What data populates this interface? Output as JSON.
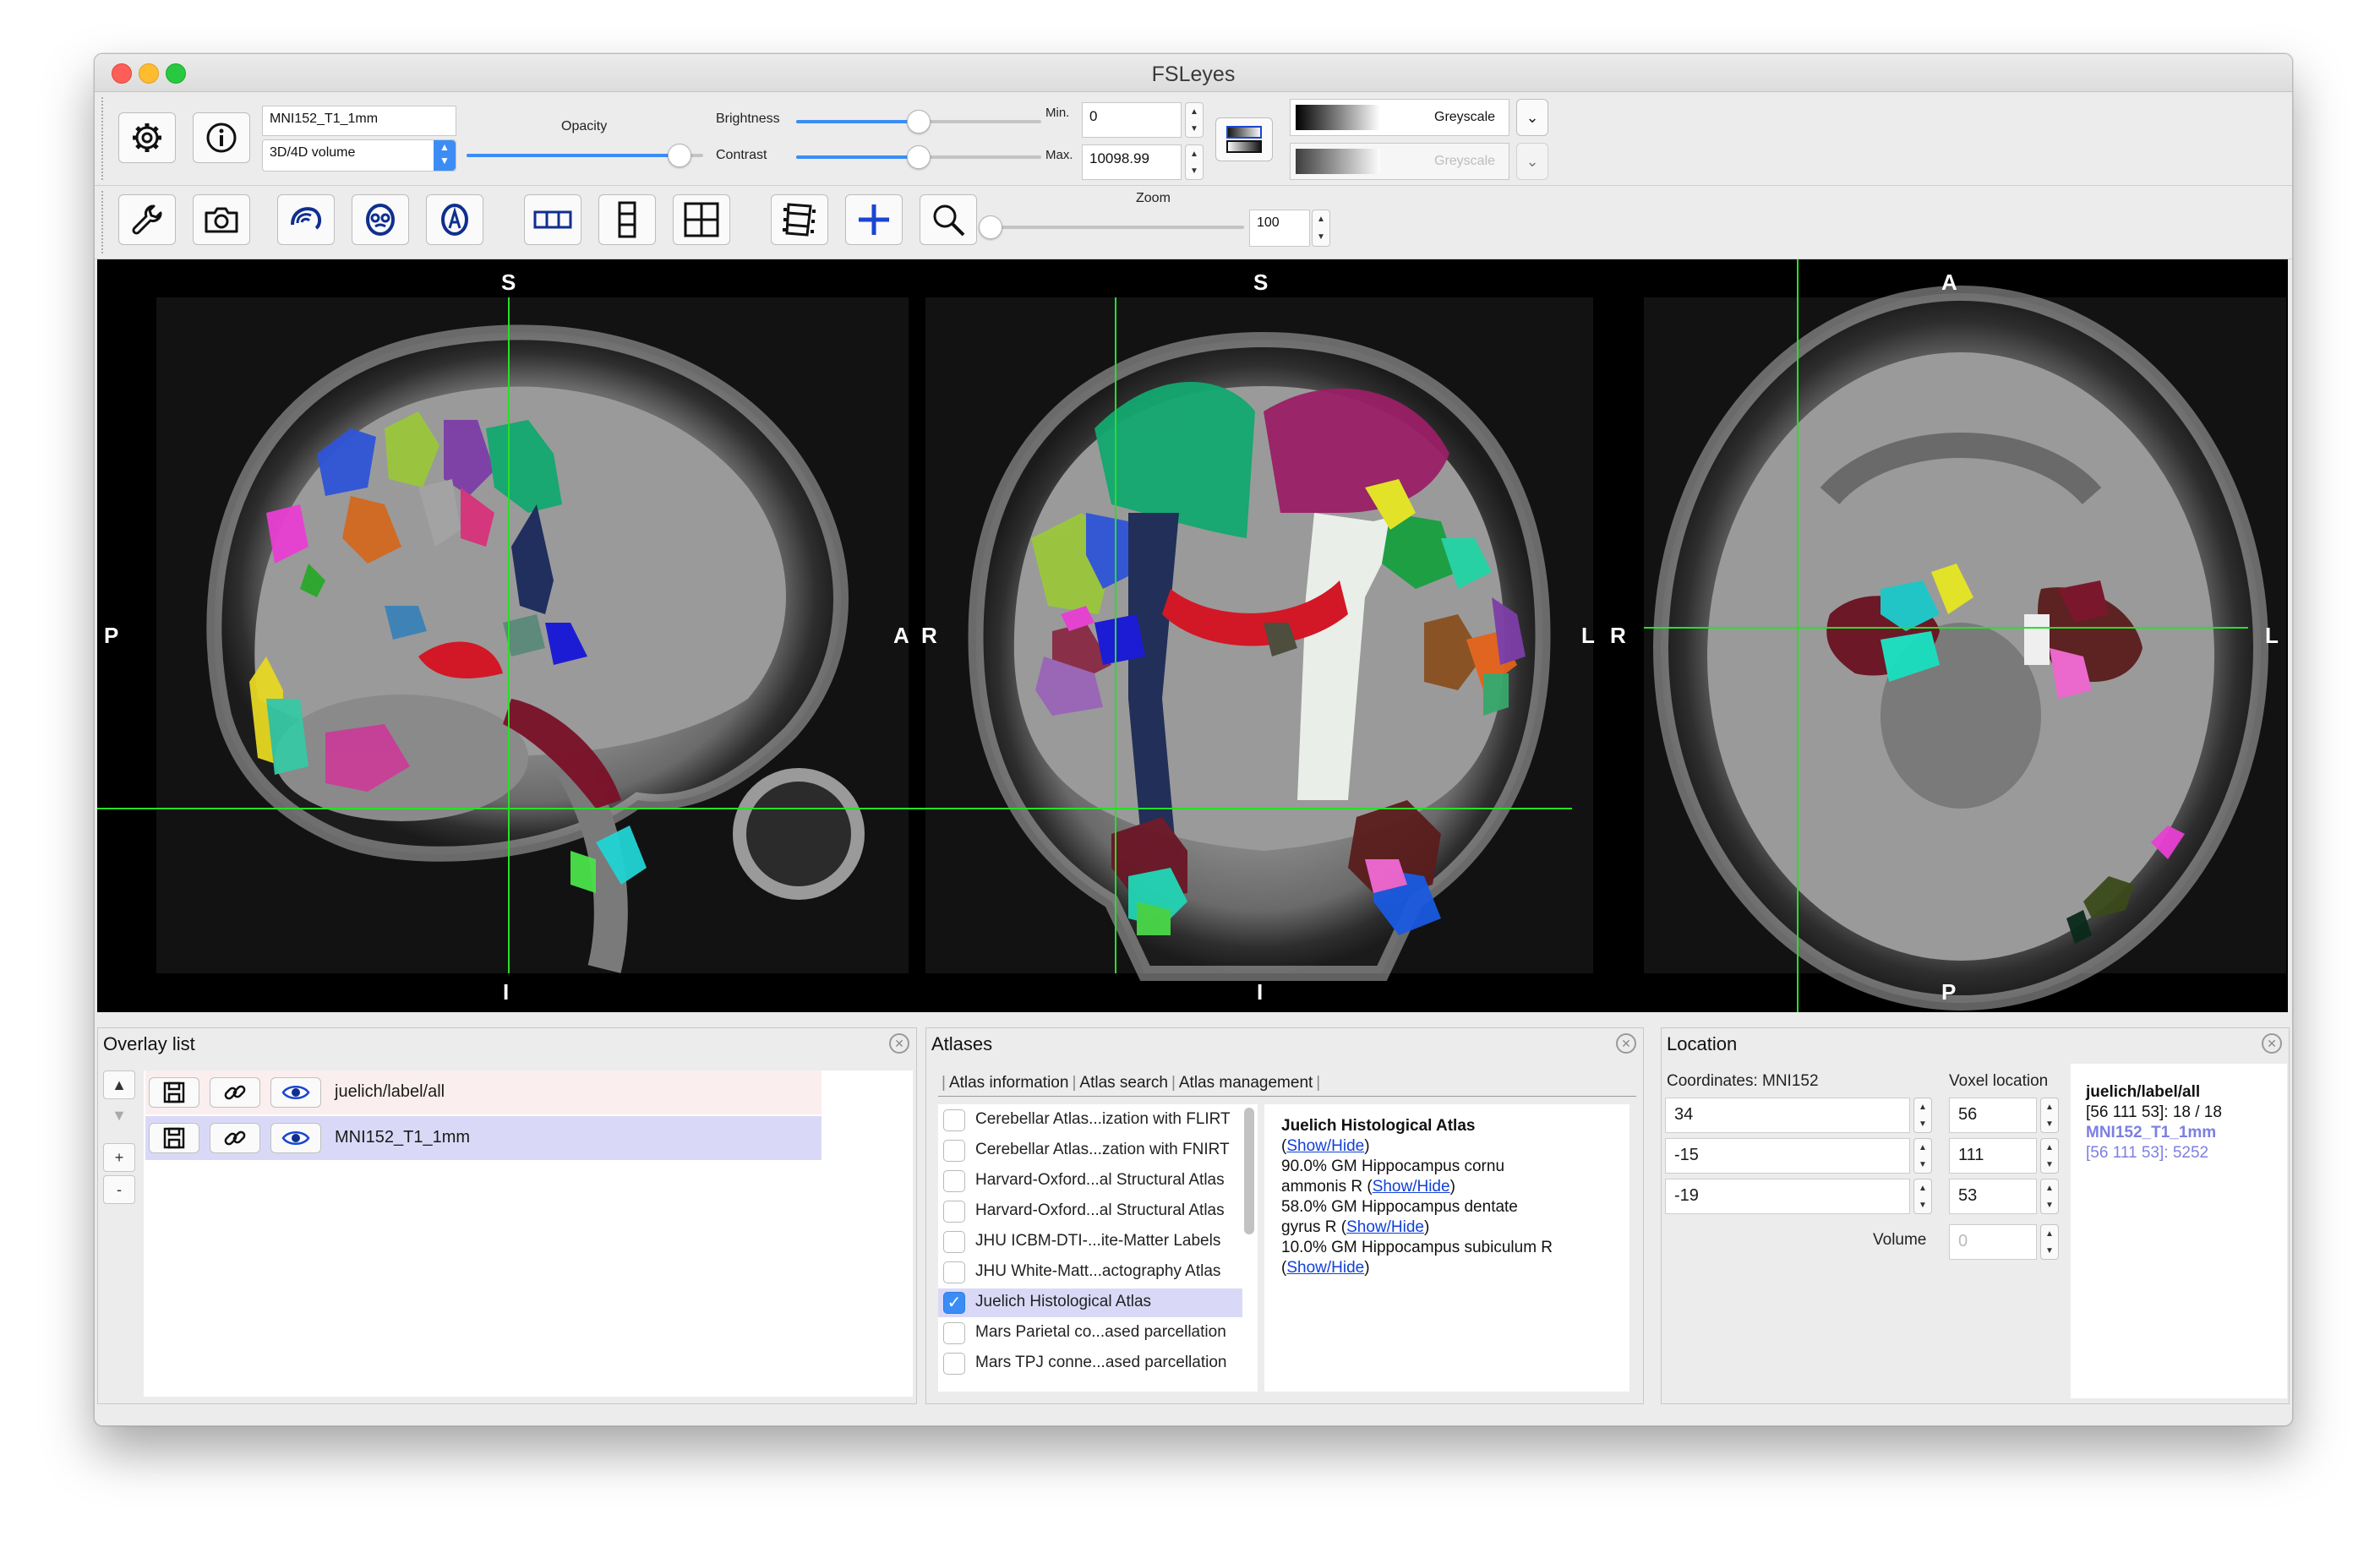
{
  "window": {
    "title": "FSLeyes"
  },
  "overlay_toolbar": {
    "overlay_name": "MNI152_T1_1mm",
    "overlay_type": "3D/4D volume",
    "opacity_label": "Opacity",
    "opacity": 0.9,
    "brightness_label": "Brightness",
    "brightness": 0.5,
    "contrast_label": "Contrast",
    "contrast": 0.5,
    "min_label": "Min.",
    "min_value": "0",
    "max_label": "Max.",
    "max_value": "10098.99",
    "colormap": "Greyscale",
    "neg_colormap": "Greyscale"
  },
  "view_toolbar": {
    "zoom_label": "Zoom",
    "zoom_value": "100",
    "zoom": 0.0
  },
  "viewer": {
    "sagittal": {
      "top": "S",
      "bottom": "I",
      "left": "P",
      "right": "A"
    },
    "coronal": {
      "top": "S",
      "bottom": "I",
      "left": "R",
      "right": "L"
    },
    "axial": {
      "top": "A",
      "bottom": "P",
      "left": "R",
      "right": "L"
    },
    "crosshair_color": "#26e026"
  },
  "overlay_list": {
    "title": "Overlay list",
    "items": [
      {
        "name": "juelich/label/all",
        "bg": "#fbeeee"
      },
      {
        "name": "MNI152_T1_1mm",
        "bg": "#d9d9f7"
      }
    ],
    "buttons": {
      "up": "▲",
      "down": "▼",
      "add": "+",
      "remove": "-"
    }
  },
  "atlases": {
    "title": "Atlases",
    "tabs": [
      "Atlas information",
      "Atlas search",
      "Atlas management"
    ],
    "items": [
      {
        "label": "Cerebellar Atlas...ization with FLIRT",
        "checked": false
      },
      {
        "label": "Cerebellar Atlas...zation with FNIRT",
        "checked": false
      },
      {
        "label": "Harvard-Oxford...al Structural Atlas",
        "checked": false
      },
      {
        "label": "Harvard-Oxford...al Structural Atlas",
        "checked": false
      },
      {
        "label": "JHU ICBM-DTI-...ite-Matter Labels",
        "checked": false
      },
      {
        "label": "JHU White-Matt...actography Atlas",
        "checked": false
      },
      {
        "label": "Juelich Histological Atlas",
        "checked": true
      },
      {
        "label": "Mars Parietal co...ased parcellation",
        "checked": false
      },
      {
        "label": "Mars TPJ conne...ased parcellation",
        "checked": false
      }
    ],
    "info": {
      "heading": "Juelich Histological Atlas",
      "show_hide": "Show/Hide",
      "lines": [
        "90.0% GM Hippocampus cornu",
        "ammonis R",
        "58.0% GM Hippocampus dentate",
        "gyrus R",
        "10.0% GM Hippocampus subiculum R"
      ]
    }
  },
  "location": {
    "title": "Location",
    "coords_label": "Coordinates: MNI152",
    "voxel_label": "Voxel location",
    "coords": [
      "34",
      "-15",
      "-19"
    ],
    "voxels": [
      "56",
      "111",
      "53"
    ],
    "volume_label": "Volume",
    "volume_value": "0",
    "summary": [
      {
        "name": "juelich/label/all",
        "value": "[56 111 53]: 18 / 18",
        "color": "#111111"
      },
      {
        "name": "MNI152_T1_1mm",
        "value": "[56 111 53]: 5252",
        "color": "#7b7fe0"
      }
    ]
  }
}
